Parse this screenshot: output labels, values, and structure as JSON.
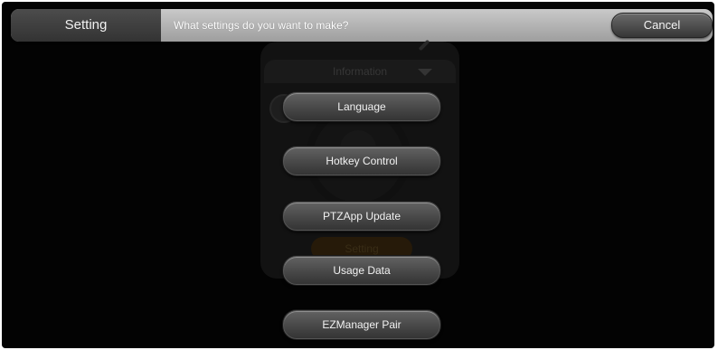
{
  "header": {
    "title": "Setting",
    "prompt": "What settings do you want to make?",
    "cancel_label": "Cancel"
  },
  "background": {
    "info_label": "Information",
    "setting_label": "Setting"
  },
  "menu": {
    "items": [
      {
        "label": "Language"
      },
      {
        "label": "Hotkey Control"
      },
      {
        "label": "PTZApp Update"
      },
      {
        "label": "Usage Data"
      },
      {
        "label": "EZManager Pair"
      }
    ]
  },
  "colors": {
    "background": "#030303",
    "header_bar": "#b4b4b4",
    "title_block": "#404040",
    "button": "#4a4a4a",
    "button_text": "#f2f2f2"
  },
  "icons": {
    "edit": "pencil-icon",
    "dropdown": "chevron-down-icon",
    "camera": "camera-icon",
    "emblem": "logo-emblem"
  }
}
